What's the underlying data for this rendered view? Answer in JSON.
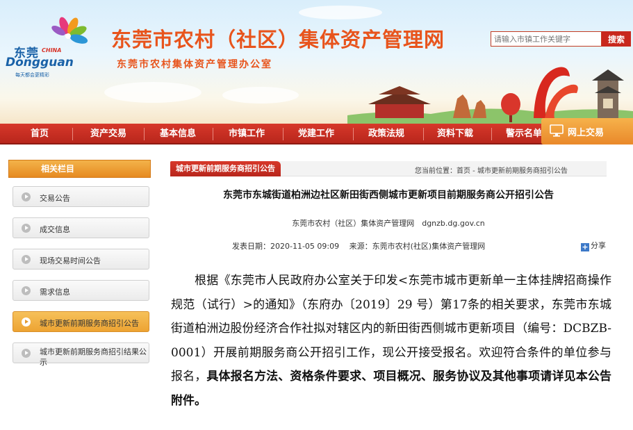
{
  "header": {
    "logo_cn": "东莞",
    "logo_china": "CHINA",
    "logo_en": "Dongguan",
    "logo_slogan": "每天都会更精彩",
    "title": "东莞市农村（社区）集体资产管理网",
    "subtitle": "东莞市农村集体资产管理办公室",
    "search": {
      "placeholder": "请输入市镇工作关键字",
      "button": "搜索"
    }
  },
  "nav": {
    "items": [
      "首页",
      "资产交易",
      "基本信息",
      "市镇工作",
      "党建工作",
      "政策法规",
      "资料下载",
      "警示名单"
    ],
    "online": "网上交易"
  },
  "sidebar": {
    "title": "相关栏目",
    "items": [
      {
        "label": "交易公告",
        "active": false
      },
      {
        "label": "成交信息",
        "active": false
      },
      {
        "label": "现场交易时间公告",
        "active": false
      },
      {
        "label": "需求信息",
        "active": false
      },
      {
        "label": "城市更新前期服务商招引公告",
        "active": true
      },
      {
        "label": "城市更新前期服务商招引结果公示",
        "active": false
      }
    ]
  },
  "breadcrumb": {
    "tab": "城市更新前期服务商招引公告",
    "prefix": "您当前位置：",
    "path": "首页 - 城市更新前期服务商招引公告"
  },
  "article": {
    "title": "东莞市东城街道柏洲边社区新田街西侧城市更新项目前期服务商公开招引公告",
    "org": "东莞市农村（社区）集体资产管理网　dgnzb.dg.gov.cn",
    "meta": "发表日期：2020-11-05 09:09　 来源：东莞市农村(社区)集体资产管理网",
    "share": "分享",
    "body_plain": "根据《东莞市人民政府办公室关于印发<东莞市城市更新单一主体挂牌招商操作规范（试行）>的通知》（东府办〔2019〕29 号）第17条的相关要求，东莞市东城街道柏洲边股份经济合作社拟对辖区内的新田街西侧城市更新项目（编号：DCBZB-0001）开展前期服务商公开招引工作，现公开接受报名。欢迎符合条件的单位参与报名，",
    "body_bold": "具体报名方法、资格条件要求、项目概况、服务协议及其他事项请详见本公告附件。"
  }
}
